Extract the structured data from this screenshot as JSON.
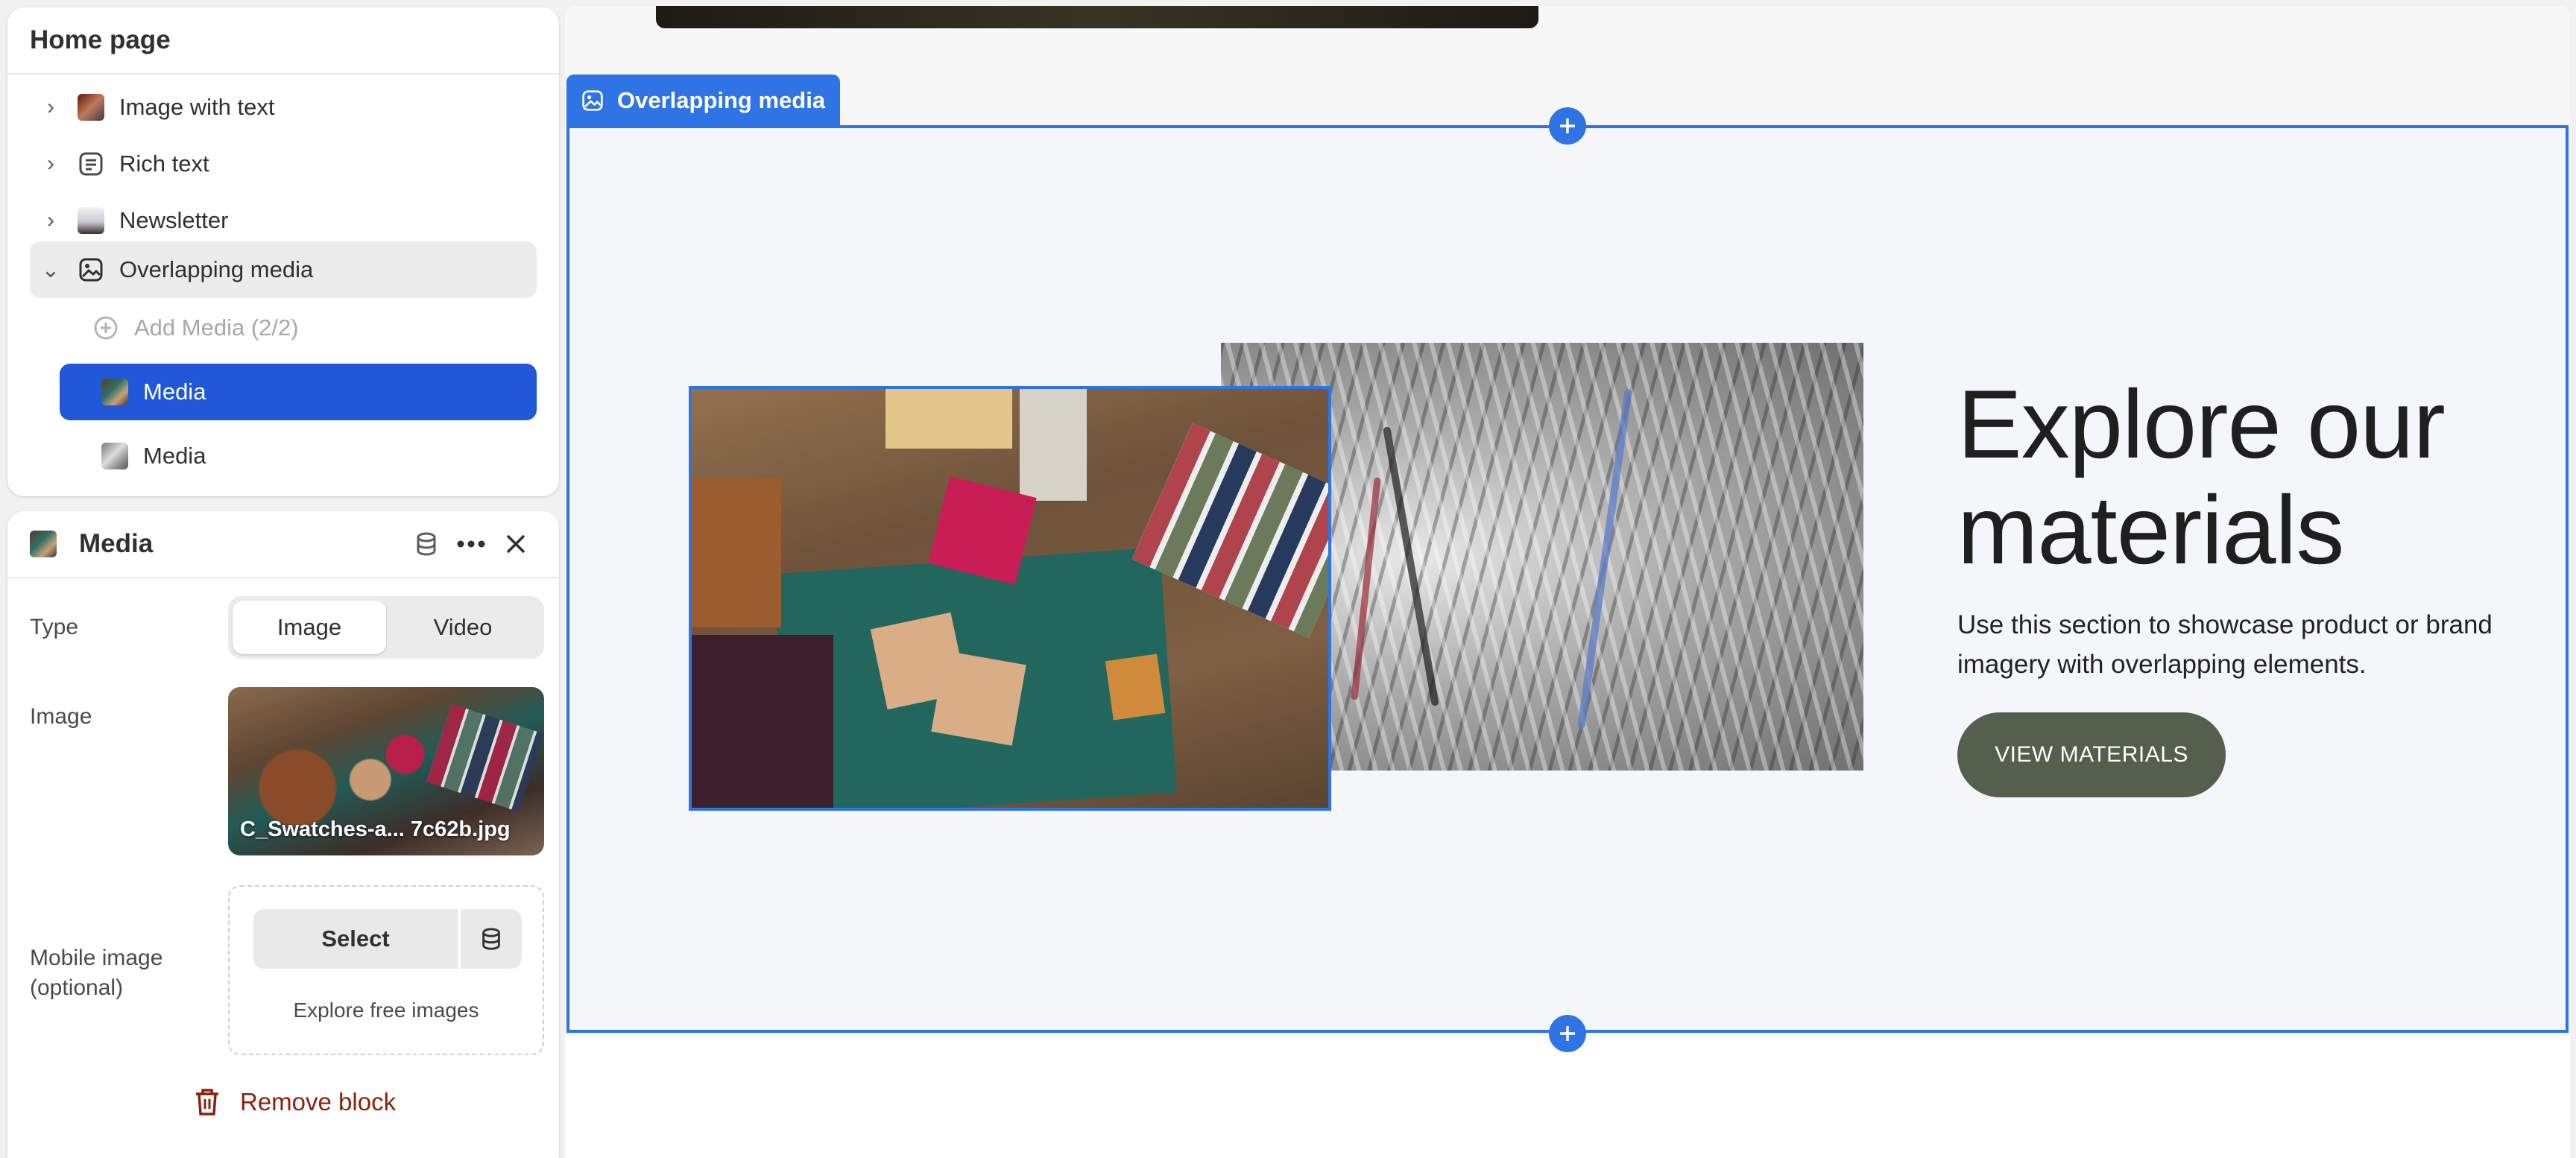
{
  "tree": {
    "title": "Home page",
    "items": [
      {
        "label": "Image with text"
      },
      {
        "label": "Rich text"
      },
      {
        "label": "Newsletter"
      },
      {
        "label": "Overlapping media"
      }
    ],
    "children": {
      "add_label": "Add Media (2/2)",
      "media_1": "Media",
      "media_2": "Media"
    }
  },
  "settings": {
    "title": "Media",
    "type_label": "Type",
    "type_options": [
      "Image",
      "Video"
    ],
    "type_selected": "Image",
    "image_label": "Image",
    "image_filename": "C_Swatches-a... 7c62b.jpg",
    "mobile_label": "Mobile image (optional)",
    "select_label": "Select",
    "explore_label": "Explore free images",
    "remove_label": "Remove block"
  },
  "preview": {
    "section_tag": "Overlapping media",
    "headline": "Explore our materials",
    "body": "Use this section to showcase product or brand imagery with overlapping elements.",
    "cta": "VIEW MATERIALS"
  },
  "colors": {
    "accent": "#2f74e4",
    "selected": "#2058d8",
    "cta": "#545f4e",
    "danger": "#8e1f0b"
  },
  "icons": {
    "collapsed": "chevron-right-icon",
    "expanded": "chevron-down-icon",
    "rich_text": "text-block-icon",
    "section": "image-section-icon",
    "add": "plus-circle-icon",
    "database": "database-icon",
    "more": "more-horizontal-icon",
    "close": "close-icon",
    "remove": "trash-icon"
  }
}
